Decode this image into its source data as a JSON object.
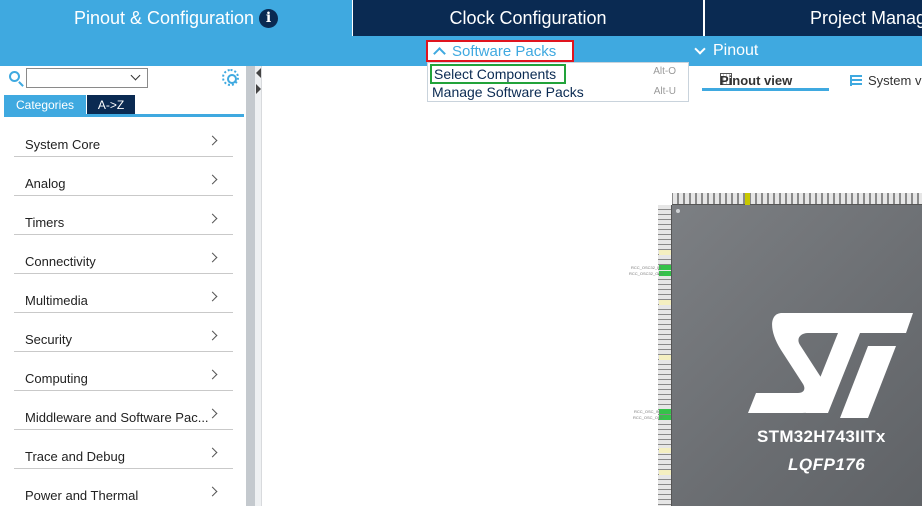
{
  "tabs": {
    "pinout": "Pinout & Configuration",
    "clock": "Clock Configuration",
    "project": "Project Manag"
  },
  "subbar": {
    "software_packs": "Software Packs",
    "pinout": "Pinout"
  },
  "dropdown": {
    "items": [
      {
        "label": "Select Components",
        "shortcut": "Alt-O"
      },
      {
        "label": "Manage Software Packs",
        "shortcut": "Alt-U"
      }
    ]
  },
  "leftpanel": {
    "tab_categories": "Categories",
    "tab_az": "A->Z",
    "categories": [
      "System Core",
      "Analog",
      "Timers",
      "Connectivity",
      "Multimedia",
      "Security",
      "Computing",
      "Middleware and Software Pac...",
      "Trace and Debug",
      "Power and Thermal"
    ]
  },
  "views": {
    "pinout_view": "Pinout view",
    "system_view": "System v"
  },
  "chip": {
    "part": "STM32H743IITx",
    "package": "LQFP176",
    "pin_labels": [
      "RCC_OSC32_IN",
      "RCC_OSC32_OUT",
      "RCC_OSC_IN",
      "RCC_OSC_OUT"
    ]
  },
  "colors": {
    "accent": "#3fa9e0",
    "navy": "#0a2a52",
    "highlight_red": "#e0141e",
    "highlight_green": "#22a33a"
  }
}
